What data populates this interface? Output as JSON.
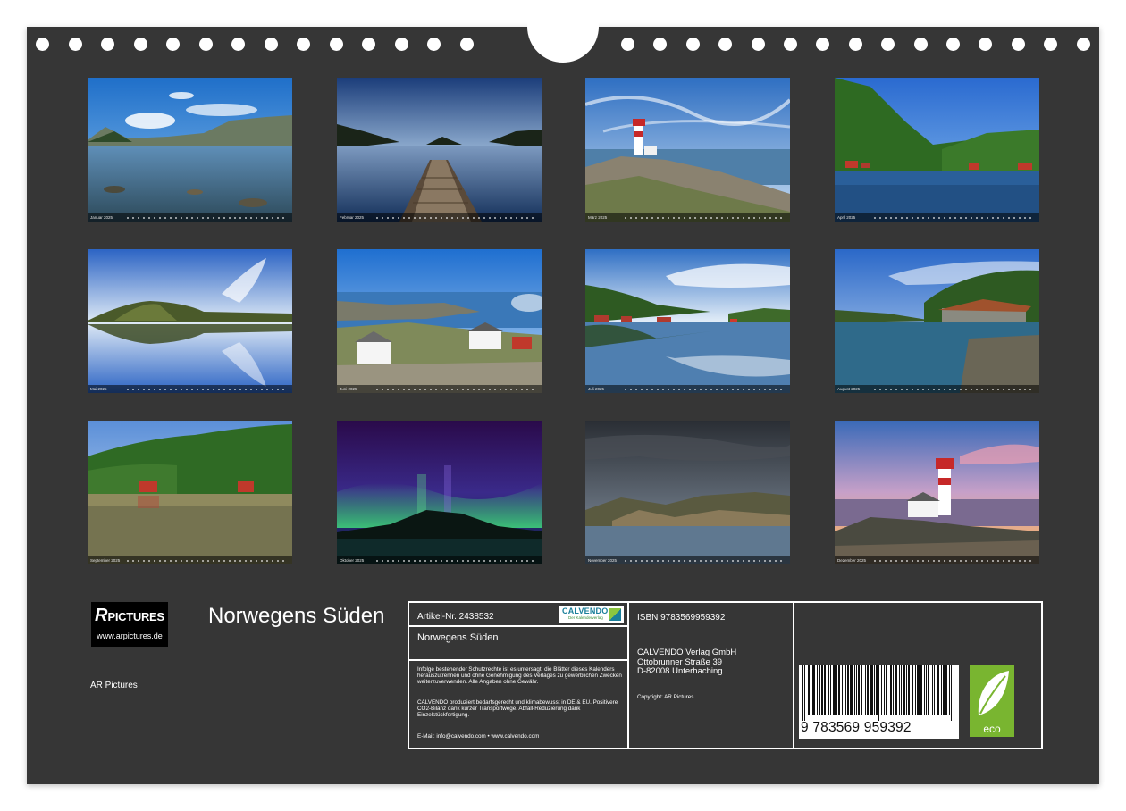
{
  "calendar": {
    "title": "Norwegens Süden",
    "author": "AR Pictures",
    "logo": {
      "r": "R",
      "rest": "PICTURES",
      "url": "www.arpictures.de"
    }
  },
  "months": [
    {
      "label": "Januar 2025",
      "scene": "lake-rocks"
    },
    {
      "label": "Februar 2025",
      "scene": "jetty-sunset"
    },
    {
      "label": "März 2025",
      "scene": "lighthouse-day"
    },
    {
      "label": "April 2025",
      "scene": "green-hills-cove"
    },
    {
      "label": "Mai 2025",
      "scene": "reflection-island"
    },
    {
      "label": "Juni 2025",
      "scene": "white-houses-coast"
    },
    {
      "label": "Juli 2025",
      "scene": "harbour-reflection"
    },
    {
      "label": "August 2025",
      "scene": "boathouse-cove"
    },
    {
      "label": "September 2025",
      "scene": "forest-shore"
    },
    {
      "label": "Oktober 2025",
      "scene": "aurora"
    },
    {
      "label": "November 2025",
      "scene": "stormy-coast"
    },
    {
      "label": "Dezember 2025",
      "scene": "lighthouse-sunset"
    }
  ],
  "info": {
    "article": "Artikel-Nr. 2438532",
    "calvendo_logo": "CALVENDO",
    "calvendo_tagline": "Der Kalenderverlag",
    "box_title": "Norwegens Süden",
    "legal_1": "Infolge bestehender Schutzrechte ist es untersagt, die Blätter dieses Kalenders herauszutrennen und ohne Genehmigung des Verlages zu gewerblichen Zwecken weiterzuverwenden. Alle Angaben ohne Gewähr.",
    "legal_2": "CALVENDO produziert bedarfsgerecht und klimabewusst in DE & EU. Positivere CO2-Bilanz dank kurzer Transportwege. Abfall-Reduzierung dank Einzelstückfertigung.",
    "contact": "E-Mail: info@calvendo.com • www.calvendo.com",
    "isbn": "ISBN 9783569959392",
    "publisher": [
      "CALVENDO Verlag GmbH",
      "Ottobrunner Straße 39",
      "D-82008 Unterhaching"
    ],
    "copyright": "Copyright: AR Pictures",
    "barcode_digits": "9 783569 959392",
    "eco_label": "eco"
  },
  "colors": {
    "background": "#363636",
    "eco": "#79b530",
    "calvendo": "#1a7f9a"
  }
}
